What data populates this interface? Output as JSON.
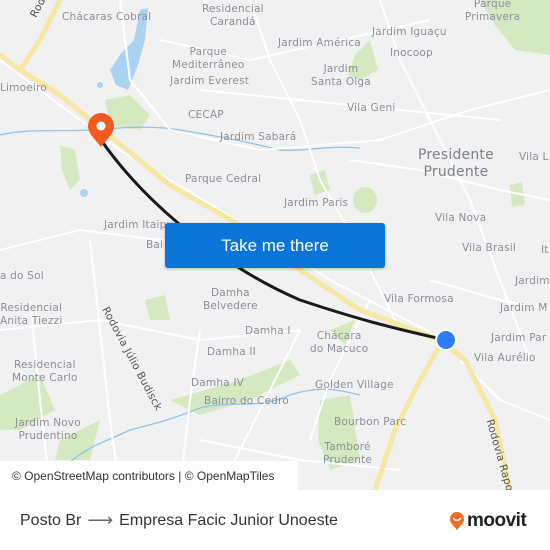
{
  "map": {
    "labels": [
      {
        "id": "chacaras-cobral",
        "text": "Chácaras Cobral"
      },
      {
        "id": "residencial-caranda",
        "text": "Residencial\nCarandá"
      },
      {
        "id": "parque-primavera",
        "text": "Parque\nPrimavera"
      },
      {
        "id": "jardim-america",
        "text": "Jardim América"
      },
      {
        "id": "jardim-iguacu",
        "text": "Jardim Iguaçu"
      },
      {
        "id": "inocoop",
        "text": "Inocoop"
      },
      {
        "id": "parque-mediterraneo",
        "text": "Parque\nMediterrâneo"
      },
      {
        "id": "jardim-everest",
        "text": "Jardim Everest"
      },
      {
        "id": "jardim-santa-olga",
        "text": "Jardim\nSanta Olga"
      },
      {
        "id": "limoeiro",
        "text": "Limoeiro"
      },
      {
        "id": "vila-geni",
        "text": "Vila Geni"
      },
      {
        "id": "cecap",
        "text": "CECAP"
      },
      {
        "id": "jardim-sabara",
        "text": "Jardim Sabará"
      },
      {
        "id": "presidente-prudente",
        "text": "Presidente\nPrudente"
      },
      {
        "id": "vila-l",
        "text": "Vila L"
      },
      {
        "id": "parque-cedral",
        "text": "Parque Cedral"
      },
      {
        "id": "jardim-paris",
        "text": "Jardim Paris"
      },
      {
        "id": "vila-nova",
        "text": "Vila Nova"
      },
      {
        "id": "jardim-itaipu",
        "text": "Jardim Itaipu"
      },
      {
        "id": "bairro",
        "text": "Bai"
      },
      {
        "id": "vila-brasil",
        "text": "Vila Brasil"
      },
      {
        "id": "it",
        "text": "It"
      },
      {
        "id": "do-sol",
        "text": "a do Sol"
      },
      {
        "id": "jardim-1",
        "text": "Jardim"
      },
      {
        "id": "vila-formosa",
        "text": "Vila Formosa"
      },
      {
        "id": "jardim-m",
        "text": "Jardim M"
      },
      {
        "id": "damha-belvedere",
        "text": "Damha\nBelvedere"
      },
      {
        "id": "residencial-anita-tiezzi",
        "text": "Residencial\nAnita Tiezzi"
      },
      {
        "id": "damha-i",
        "text": "Damha I"
      },
      {
        "id": "jardim-par",
        "text": "Jardim Par"
      },
      {
        "id": "chacara-do-macuco",
        "text": "Chácara\ndo Macuco"
      },
      {
        "id": "damha-ii",
        "text": "Damha II"
      },
      {
        "id": "vila-aurelio",
        "text": "Vila Aurélio"
      },
      {
        "id": "residencial-monte-carlo",
        "text": "Residencial\nMonte Carlo"
      },
      {
        "id": "damha-iv",
        "text": "Damha IV"
      },
      {
        "id": "golden-village",
        "text": "Golden Village"
      },
      {
        "id": "bairro-do-cedro",
        "text": "Bairro do Cedro"
      },
      {
        "id": "bourbon-parc",
        "text": "Bourbon Parc"
      },
      {
        "id": "jardim-novo-prudentino",
        "text": "Jardim Novo\nPrudentino"
      },
      {
        "id": "tambore-prudente",
        "text": "Tamboré\nPrudente"
      }
    ],
    "roads": {
      "rodovia-top": "Rodovia",
      "rodovia-julio-budisck": "Rodovia Júlio Budisck",
      "rodovia-raposo": "Rodovia Raposo"
    },
    "origin_marker": {
      "icon": "origin-pin-icon",
      "color": "#f25a1f"
    },
    "destination_marker": {
      "icon": "destination-dot-icon",
      "color": "#2f7df6"
    },
    "route_color": "#1a1a1a",
    "highway_color": "#f7e9a6",
    "water_color": "#a8d3f3",
    "park_color": "#cfe7b7"
  },
  "cta": {
    "label": "Take me there",
    "color": "#0a74d9"
  },
  "attribution": "© OpenStreetMap contributors | © OpenMapTiles",
  "footer": {
    "origin": "Posto Br",
    "arrow": "⟶",
    "destination": "Empresa Facic Junior Unoeste",
    "brand": "moovit",
    "brand_color": "#f26b21"
  }
}
